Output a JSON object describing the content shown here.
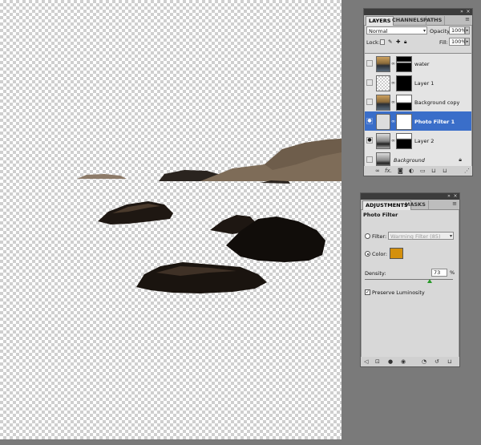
{
  "layers_panel": {
    "tabs": [
      "LAYERS",
      "CHANNELS",
      "PATHS"
    ],
    "active_tab": "LAYERS",
    "blend_mode": "Normal",
    "opacity_label": "Opacity:",
    "opacity_value": "100%",
    "lock_label": "Lock:",
    "fill_label": "Fill:",
    "fill_value": "100%",
    "layers": [
      {
        "name": "water"
      },
      {
        "name": "Layer 1"
      },
      {
        "name": "Background copy"
      },
      {
        "name": "Photo Filter 1",
        "selected": true,
        "visible": true
      },
      {
        "name": "Layer 2",
        "visible": true
      },
      {
        "name": "Background"
      }
    ]
  },
  "adjustments_panel": {
    "tabs": [
      "ADJUSTMENTS",
      "MASKS"
    ],
    "active_tab": "ADJUSTMENTS",
    "title": "Photo Filter",
    "filter_label": "Filter:",
    "filter_value": "Warming Filter (85)",
    "color_label": "Color:",
    "color_swatch": "#d4900c",
    "density_label": "Density:",
    "density_value": "73",
    "density_unit": "%",
    "preserve_label": "Preserve Luminosity",
    "preserve_checked": true
  },
  "icons": [
    "eye-icon",
    "chain-link-icon",
    "lock-icon",
    "fx-icon",
    "mask-icon",
    "adjustment-icon",
    "folder-icon",
    "new-layer-icon",
    "trash-icon",
    "panel-menu-icon",
    "reset-icon",
    "visibility-icon",
    "view-previous-icon",
    "clip-icon",
    "back-arrow-icon",
    "expand-icon"
  ],
  "colors": {
    "selected_row": "#3a6ec9",
    "photo_filter_color": "#d4900c"
  }
}
